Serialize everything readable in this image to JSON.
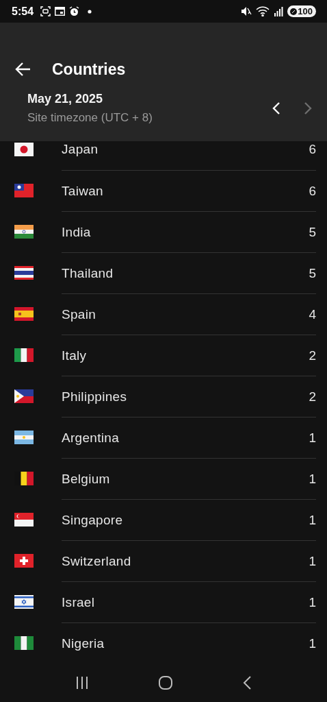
{
  "status_bar": {
    "time": "5:54",
    "battery": "100"
  },
  "header": {
    "title": "Countries",
    "date": "May 21, 2025",
    "timezone": "Site timezone (UTC + 8)",
    "prev_disabled": false,
    "next_disabled": true
  },
  "countries": [
    {
      "kind": "jp",
      "name": "Japan",
      "count": "6"
    },
    {
      "kind": "tw",
      "name": "Taiwan",
      "count": "6"
    },
    {
      "kind": "in",
      "name": "India",
      "count": "5"
    },
    {
      "kind": "th",
      "name": "Thailand",
      "count": "5"
    },
    {
      "kind": "es",
      "name": "Spain",
      "count": "4"
    },
    {
      "kind": "it",
      "name": "Italy",
      "count": "2"
    },
    {
      "kind": "ph",
      "name": "Philippines",
      "count": "2"
    },
    {
      "kind": "ar",
      "name": "Argentina",
      "count": "1"
    },
    {
      "kind": "be",
      "name": "Belgium",
      "count": "1"
    },
    {
      "kind": "sg",
      "name": "Singapore",
      "count": "1"
    },
    {
      "kind": "ch",
      "name": "Switzerland",
      "count": "1"
    },
    {
      "kind": "il",
      "name": "Israel",
      "count": "1"
    },
    {
      "kind": "ng",
      "name": "Nigeria",
      "count": "1"
    }
  ]
}
